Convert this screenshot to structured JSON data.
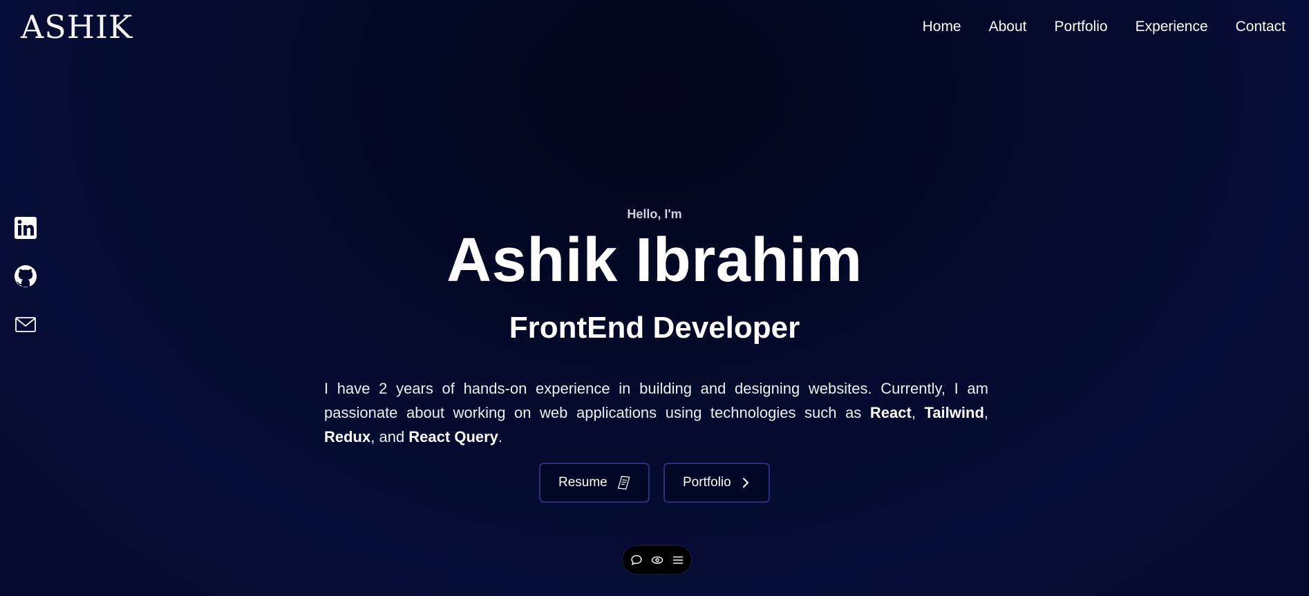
{
  "header": {
    "logo": "ASHIK",
    "nav": [
      {
        "label": "Home"
      },
      {
        "label": "About"
      },
      {
        "label": "Portfolio"
      },
      {
        "label": "Experience"
      },
      {
        "label": "Contact"
      }
    ]
  },
  "social": [
    {
      "icon": "linkedin-icon"
    },
    {
      "icon": "github-icon"
    },
    {
      "icon": "mail-icon"
    }
  ],
  "hero": {
    "greeting": "Hello, I'm",
    "name": "Ashik Ibrahim",
    "role": "FrontEnd Developer",
    "bio_intro": "I have 2 years of hands-on experience in building and designing websites. Currently, I am passionate about working on web applications using technologies such as ",
    "tech": [
      "React",
      "Tailwind",
      "Redux",
      "React Query"
    ],
    "sep1": ", ",
    "sep2": ", ",
    "sep3": ", and ",
    "end": "."
  },
  "buttons": {
    "resume": "Resume",
    "portfolio": "Portfolio"
  },
  "dock": {
    "icons": [
      "chat-icon",
      "eye-icon",
      "menu-icon"
    ]
  },
  "colors": {
    "background": "#050a2e",
    "button_border": "#2b2f79",
    "text": "#ffffff"
  }
}
